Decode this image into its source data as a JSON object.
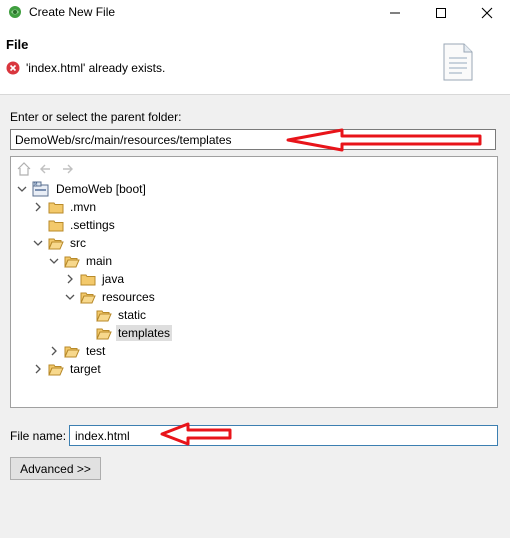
{
  "window": {
    "title": "Create New File"
  },
  "header": {
    "title": "File",
    "error_message": "'index.html' already exists."
  },
  "parent_folder": {
    "label": "Enter or select the parent folder:",
    "value": "DemoWeb/src/main/resources/templates"
  },
  "tree": {
    "items": [
      {
        "label": "DemoWeb [boot]",
        "type": "project"
      },
      {
        "label": ".mvn",
        "type": "folder"
      },
      {
        "label": ".settings",
        "type": "folder"
      },
      {
        "label": "src",
        "type": "folder"
      },
      {
        "label": "main",
        "type": "folder"
      },
      {
        "label": "java",
        "type": "folder"
      },
      {
        "label": "resources",
        "type": "folder"
      },
      {
        "label": "static",
        "type": "folder"
      },
      {
        "label": "templates",
        "type": "folder",
        "selected": true
      },
      {
        "label": "test",
        "type": "folder"
      },
      {
        "label": "target",
        "type": "folder"
      }
    ]
  },
  "file_name": {
    "label": "File name:",
    "value": "index.html"
  },
  "buttons": {
    "advanced": "Advanced >>"
  },
  "colors": {
    "annotation_arrow": "#e8141a",
    "folder_fill": "#f3c96b",
    "error": "#d9363e"
  }
}
